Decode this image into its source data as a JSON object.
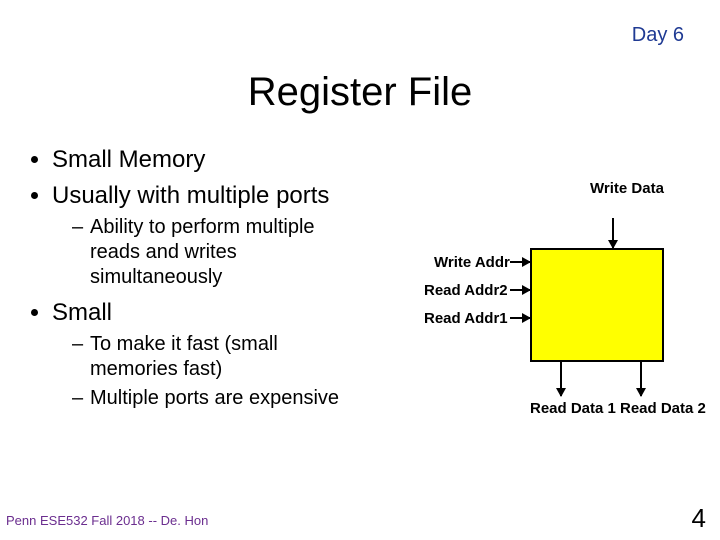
{
  "header": {
    "day": "Day 6"
  },
  "title": "Register File",
  "bullets": {
    "b1": "Small Memory",
    "b2": "Usually with multiple ports",
    "b2_sub1": "Ability to perform multiple reads and writes simultaneously",
    "b3": "Small",
    "b3_sub1": "To make it fast (small memories fast)",
    "b3_sub2": "Multiple ports are expensive"
  },
  "diagram": {
    "write_data": "Write Data",
    "write_addr": "Write Addr",
    "read_addr2": "Read Addr2",
    "read_addr1": "Read Addr1",
    "read_data1": "Read Data 1",
    "read_data2": "Read Data 2"
  },
  "footer": "Penn ESE532 Fall 2018 -- De. Hon",
  "page_number": "4"
}
